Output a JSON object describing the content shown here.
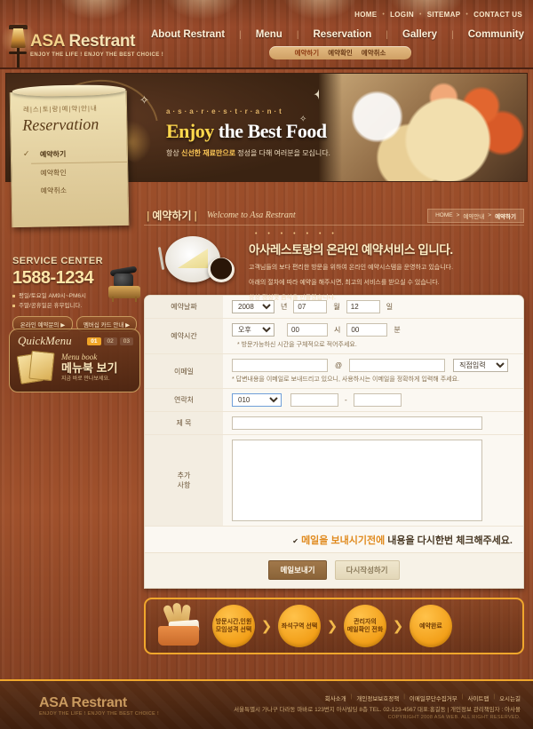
{
  "header": {
    "utility": [
      "HOME",
      "LOGIN",
      "SITEMAP",
      "CONTACT US"
    ],
    "logo_title_a": "ASA",
    "logo_title_b": " Restrant",
    "logo_tagline": "ENJOY THE LIFE ! ENJOY THE BEST CHOICE !",
    "gnb": [
      "About Restrant",
      "Menu",
      "Reservation",
      "Gallery",
      "Community"
    ],
    "subnav": [
      "예약하기",
      "예약확인",
      "예약취소"
    ],
    "icons": {
      "lamp": "wall-lamp-icon"
    }
  },
  "hero": {
    "kerned": "a·s·a·r·e·s·t·r·a·n·t",
    "title_em": "Enjoy",
    "title_rest": " the Best Food",
    "desc_pre": "항상 ",
    "desc_hl": "신선한 재료만으로",
    "desc_post": " 정성을 다해 여러분을 모십니다."
  },
  "scroll_menu": {
    "korean_label": "레|스|토|랑|예|약|안|내",
    "script_title": "Reservation",
    "items": [
      "예약하기",
      "예약확인",
      "예약취소"
    ],
    "active_index": 0
  },
  "service_center": {
    "title": "SERVICE CENTER",
    "tel": "1588-1234",
    "notes": [
      "평일/토요일 AM9시~PM6시",
      "주말/공휴일은 휴무입니다."
    ],
    "buttons": [
      "온라인 예약문의 ▶",
      "멤버십 카드 안내 ▶"
    ]
  },
  "quick_menu": {
    "title": "QuickMenu",
    "tabs": [
      "01",
      "02",
      "03"
    ],
    "active_tab": 0,
    "en_label": "Menu book",
    "kr_label": "메뉴북 보기",
    "sub_label": "지금 바로 만나보세요."
  },
  "page_bar": {
    "title": "예약하기",
    "welcome": "Welcome to Asa Restrant",
    "breadcrumb": [
      "HOME",
      "예약안내",
      "예약하기"
    ]
  },
  "intro": {
    "heading": "아사레스토랑의 온라인 예약서비스 입니다.",
    "lines": [
      "고객님들의 보다 편리한 방문을 위하여 온라인 예약시스템을 운영하고 있습니다.",
      "아래의 절차에 따라 예약을 해주시면, 최고의 서비스를 받으실 수 있습니다.",
      "항상 정성껏 음식을 만들겠습니다."
    ]
  },
  "form": {
    "date": {
      "label": "예약날짜",
      "year_value": "2008",
      "year_unit": "년",
      "month_value": "07",
      "month_unit": "월",
      "day_value": "12",
      "day_unit": "일"
    },
    "time": {
      "label": "예약시간",
      "ampm_value": "오후",
      "hour_value": "00",
      "hour_unit": "시",
      "minute_value": "00",
      "minute_unit": "분",
      "hint": "* 방문가능하신 시간을 구체적으로 적어주세요."
    },
    "email": {
      "label": "이메일",
      "local_value": "",
      "at": "@",
      "domain_value": "",
      "select_value": "직접입력",
      "hint": "* 답변내용을 이메일로 보내드리고 있으니, 사용하시는 이메일을 정확하게 입력해 주세요."
    },
    "phone": {
      "label": "연락처",
      "prefix_value": "010",
      "mid_value": "",
      "dash": "-",
      "last_value": ""
    },
    "subject": {
      "label": "제 목",
      "value": ""
    },
    "memo": {
      "label_l1": "추가",
      "label_l2": "사항",
      "value": ""
    },
    "note": {
      "check": "✔",
      "highlight": "메일을 보내시기전에",
      "rest": " 내용을 다시한번 체크해주세요."
    },
    "buttons": {
      "submit": "메일보내기",
      "reset": "다시작성하기"
    }
  },
  "steps": {
    "items": [
      "방문시간,인원\n모임성격 선택",
      "좌석구역 선택",
      "관리자의\n메일확인 전화",
      "예약완료"
    ],
    "arrow": "❯"
  },
  "footer": {
    "logo_title": "ASA Restrant",
    "logo_tagline": "ENJOY THE LIFE ! ENJOY THE BEST CHOICE !",
    "nav": [
      "회사소개",
      "개인정보보호정책",
      "이메일무단수집거부",
      "사이트맵",
      "오시는길"
    ],
    "address": "서울특별시 가나구 다라동 마바로 123번지 아사빌딩 8층 TEL. 02-123-4567  대표:홍길동  |  개인정보 관리책임자 : 아사몰",
    "copyright": "COPYRIGHT 2008 ASA WEB. ALL RIGHT RESERVED."
  },
  "colors": {
    "accent_orange": "#f0a72c",
    "cream": "#fbf8f2",
    "wood": "#8e4526"
  }
}
